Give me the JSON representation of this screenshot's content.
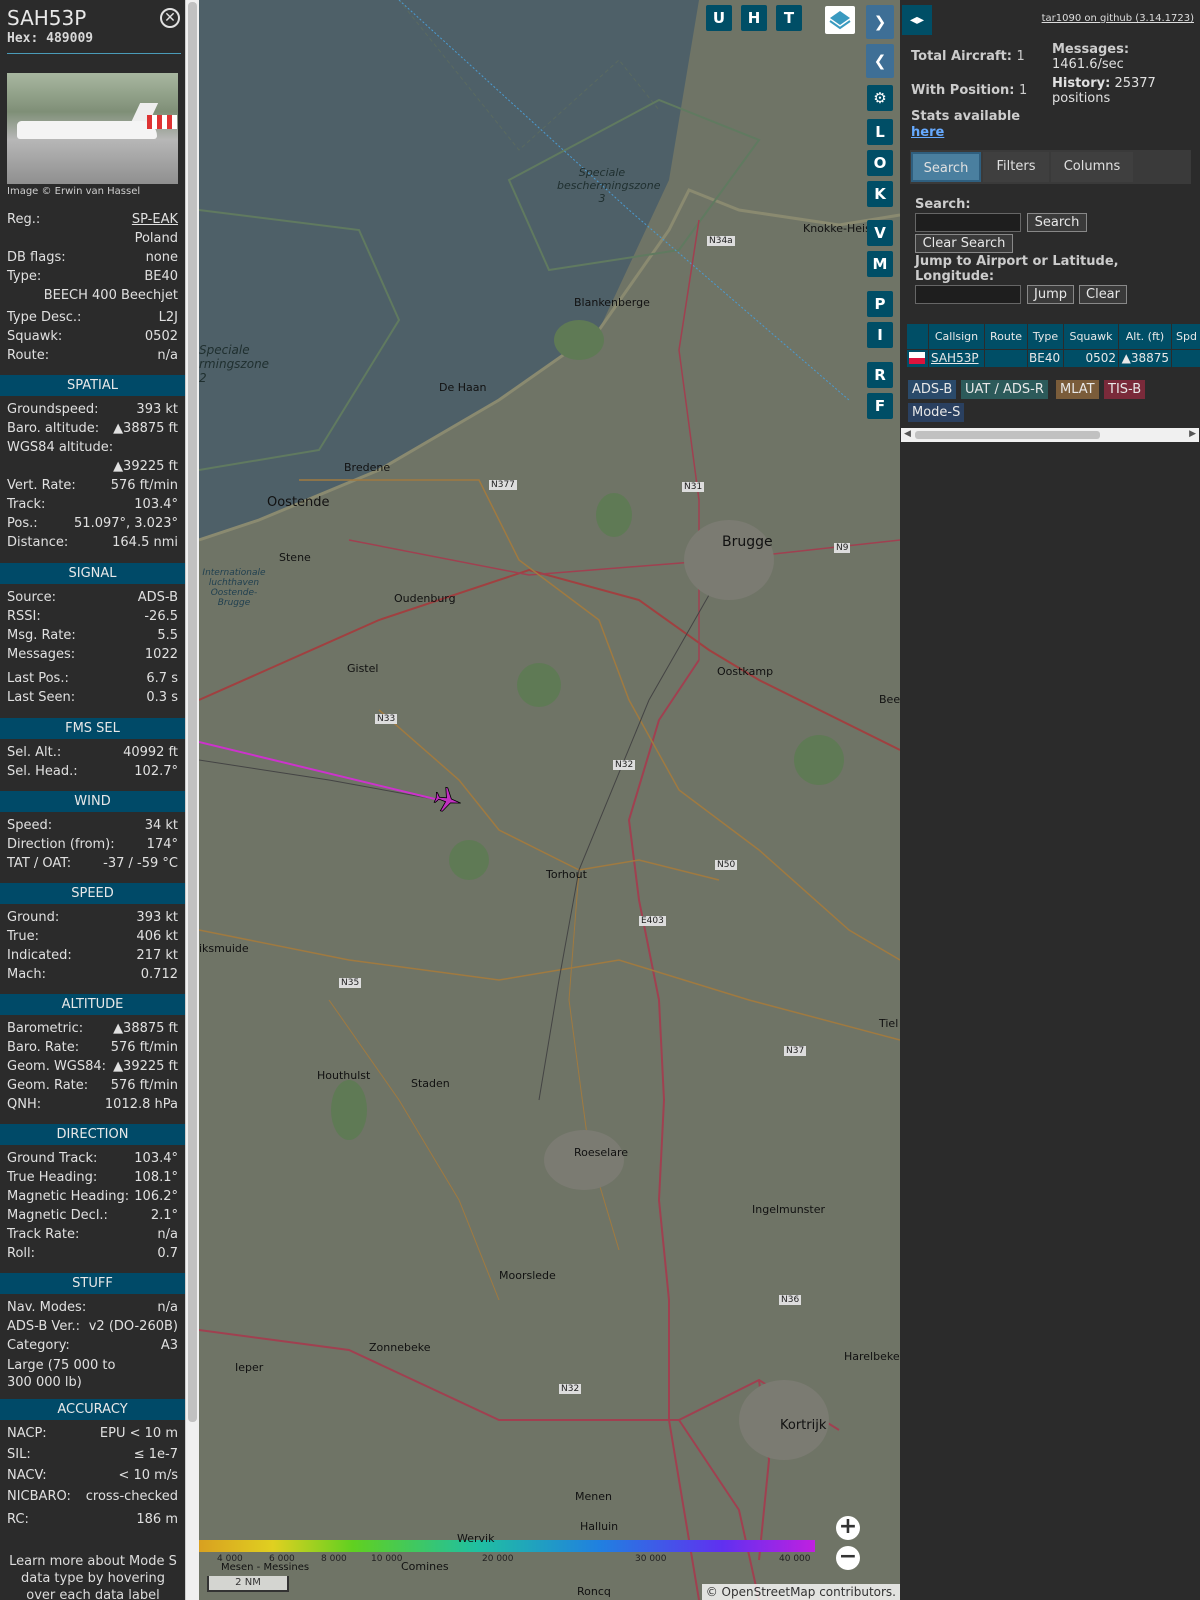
{
  "aircraft": {
    "callsign": "SAH53P",
    "hex": "Hex: 489009",
    "photo_caption": "Image © Erwin van Hassel",
    "close_glyph": "⨂"
  },
  "info": {
    "reg_k": "Reg.:",
    "reg_v": "SP-EAK",
    "country": "Poland",
    "dbflags_k": "DB flags:",
    "dbflags_v": "none",
    "type_k": "Type:",
    "type_v": "BE40",
    "type_name": "BEECH 400 Beechjet",
    "typedesc_k": "Type Desc.:",
    "typedesc_v": "L2J",
    "squawk_k": "Squawk:",
    "squawk_v": "0502",
    "route_k": "Route:",
    "route_v": "n/a"
  },
  "spatial": {
    "title": "SPATIAL",
    "gs_k": "Groundspeed:",
    "gs_v": "393 kt",
    "baro_k": "Baro. altitude:",
    "baro_v": "▲38875 ft",
    "wgs_k": "WGS84 altitude:",
    "wgs_v": "▲39225 ft",
    "vr_k": "Vert. Rate:",
    "vr_v": "576 ft/min",
    "track_k": "Track:",
    "track_v": "103.4°",
    "pos_k": "Pos.:",
    "pos_v": "51.097°, 3.023°",
    "dist_k": "Distance:",
    "dist_v": "164.5 nmi"
  },
  "signal": {
    "title": "SIGNAL",
    "src_k": "Source:",
    "src_v": "ADS-B",
    "rssi_k": "RSSI:",
    "rssi_v": "-26.5",
    "rate_k": "Msg. Rate:",
    "rate_v": "5.5",
    "msg_k": "Messages:",
    "msg_v": "1022",
    "lpos_k": "Last Pos.:",
    "lpos_v": "6.7 s",
    "lseen_k": "Last Seen:",
    "lseen_v": "0.3 s"
  },
  "fms": {
    "title": "FMS SEL",
    "alt_k": "Sel. Alt.:",
    "alt_v": "40992 ft",
    "head_k": "Sel. Head.:",
    "head_v": "102.7°"
  },
  "wind": {
    "title": "WIND",
    "speed_k": "Speed:",
    "speed_v": "34 kt",
    "dir_k": "Direction (from):",
    "dir_v": "174°",
    "tat_k": "TAT / OAT:",
    "tat_v": "-37 / -59 °C"
  },
  "speed": {
    "title": "SPEED",
    "ground_k": "Ground:",
    "ground_v": "393 kt",
    "true_k": "True:",
    "true_v": "406 kt",
    "ind_k": "Indicated:",
    "ind_v": "217 kt",
    "mach_k": "Mach:",
    "mach_v": "0.712"
  },
  "altitude": {
    "title": "ALTITUDE",
    "baro_k": "Barometric:",
    "baro_v": "▲38875 ft",
    "brate_k": "Baro. Rate:",
    "brate_v": "576 ft/min",
    "geom_k": "Geom. WGS84:",
    "geom_v": "▲39225 ft",
    "grate_k": "Geom. Rate:",
    "grate_v": "576 ft/min",
    "qnh_k": "QNH:",
    "qnh_v": "1012.8 hPa"
  },
  "direction": {
    "title": "DIRECTION",
    "gt_k": "Ground Track:",
    "gt_v": "103.4°",
    "th_k": "True Heading:",
    "th_v": "108.1°",
    "mh_k": "Magnetic Heading:",
    "mh_v": "106.2°",
    "md_k": "Magnetic Decl.:",
    "md_v": "2.1°",
    "tr_k": "Track Rate:",
    "tr_v": "n/a",
    "roll_k": "Roll:",
    "roll_v": "0.7"
  },
  "stuff": {
    "title": "STUFF",
    "nav_k": "Nav. Modes:",
    "nav_v": "n/a",
    "adsb_k": "ADS-B Ver.:",
    "adsb_v": "v2 (DO-260B)",
    "cat_k": "Category:",
    "cat_v": "A3",
    "cat_desc": "Large (75 000 to 300 000 lb)"
  },
  "accuracy": {
    "title": "ACCURACY",
    "nacp_k": "NACP:",
    "nacp_v": "EPU < 10 m",
    "sil_k": "SIL:",
    "sil_v": "≤ 1e-7",
    "nacv_k": "NACV:",
    "nacv_v": "< 10 m/s",
    "nic_k": "NICBARO:",
    "nic_v": "cross-checked",
    "rc_k": "RC:",
    "rc_v": "186 m"
  },
  "footer_note": "Learn more about Mode S data type by hovering over each data label",
  "map": {
    "buttons_top": [
      "U",
      "H",
      "T"
    ],
    "buttons_side": [
      "L",
      "O",
      "K",
      "V",
      "M",
      "P",
      "I",
      "R",
      "F"
    ],
    "place_labels": {
      "oostende": "Oostende",
      "brugge": "Brugge",
      "blankenberge": "Blankenberge",
      "dehaan": "De Haan",
      "bredene": "Bredene",
      "stene": "Stene",
      "oudenburg": "Oudenburg",
      "gistel": "Gistel",
      "oostkamp": "Oostkamp",
      "torhout": "Torhout",
      "diksmuide": "iksmuide",
      "houthulst": "Houthulst",
      "staden": "Staden",
      "roeselare": "Roeselare",
      "ingelmunster": "Ingelmunster",
      "moorslede": "Moorslede",
      "zonnebeke": "Zonnebeke",
      "ieper": "Ieper",
      "menen": "Menen",
      "kortrijk": "Kortrijk",
      "harelbeke": "Harelbeke",
      "halluin": "Halluin",
      "knokke": "Knokke-Heist",
      "beernem": "Bee",
      "tielt": "Tiel",
      "wervik": "Wervik",
      "comines": "Comines",
      "mesen": "Mesen - Messines",
      "roncq": "Roncq",
      "zone3": "Speciale beschermingszone 3",
      "zone2": "Speciale rmingszone 2",
      "airport": "Internationale luchthaven Oostende-Brugge"
    },
    "roads": [
      "N34a",
      "N377",
      "N31",
      "N9",
      "N33",
      "N32",
      "N50",
      "E403",
      "N35",
      "N37",
      "N36",
      "N32"
    ],
    "altitude_scale": [
      "4 000",
      "6 000",
      "8 000",
      "10 000",
      "20 000",
      "30 000",
      "40 000"
    ],
    "scale_label": "2 NM",
    "attribution": "© OpenStreetMap contributors."
  },
  "panel": {
    "github": "tar1090 on github (3.14.1723)",
    "total_k": "Total Aircraft:",
    "total_v": "1",
    "withpos_k": "With Position:",
    "withpos_v": "1",
    "messages_k": "Messages:",
    "messages_v": "1461.6/sec",
    "history_k": "History:",
    "history_v": "25377 positions",
    "stats_k": "Stats available",
    "stats_link": "here",
    "tabs": [
      "Search",
      "Filters",
      "Columns"
    ],
    "search_label": "Search:",
    "search_btn": "Search",
    "clear_search_btn": "Clear Search",
    "jump_label": "Jump to Airport or Latitude, Longitude:",
    "jump_btn": "Jump",
    "clear_btn": "Clear",
    "columns": [
      "Callsign",
      "Route",
      "Type",
      "Squawk",
      "Alt. (ft)",
      "Spd"
    ],
    "row": {
      "callsign": "SAH53P",
      "route": "",
      "type": "BE40",
      "squawk": "0502",
      "alt": "▲38875"
    },
    "legend": [
      "ADS-B",
      "UAT / ADS-R",
      "MLAT",
      "TIS-B",
      "Mode-S"
    ]
  },
  "colors": {
    "accent": "#004e66",
    "adsb": "#2a4a6a",
    "uat": "#2c5a5a",
    "mlat": "#7a5c3a",
    "tisb": "#7a2a3a",
    "modes": "#2a4060",
    "track": "#cc33cc"
  }
}
